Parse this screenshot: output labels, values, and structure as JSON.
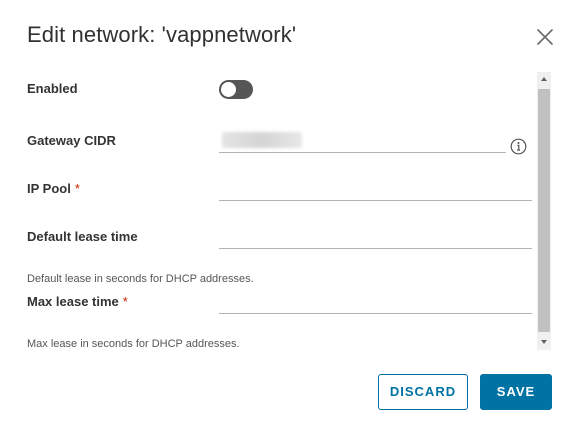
{
  "dialog": {
    "title": "Edit network: 'vappnetwork'"
  },
  "form": {
    "enabled": {
      "label": "Enabled",
      "value": false
    },
    "gateway_cidr": {
      "label": "Gateway CIDR",
      "value": ""
    },
    "ip_pool": {
      "label": "IP Pool",
      "required_marker": "*",
      "value": ""
    },
    "default_lease_time": {
      "label": "Default lease time",
      "value": "",
      "helper": "Default lease in seconds for DHCP addresses."
    },
    "max_lease_time": {
      "label": "Max lease time",
      "required_marker": "*",
      "value": "",
      "helper": "Max lease in seconds for DHCP addresses."
    }
  },
  "footer": {
    "discard_label": "DISCARD",
    "save_label": "SAVE"
  },
  "colors": {
    "primary": "#0072a3",
    "required": "#c92100",
    "toggle_off": "#565656"
  },
  "icons": [
    "close-icon",
    "info-icon",
    "scroll-up-arrow-icon",
    "scroll-down-arrow-icon"
  ]
}
